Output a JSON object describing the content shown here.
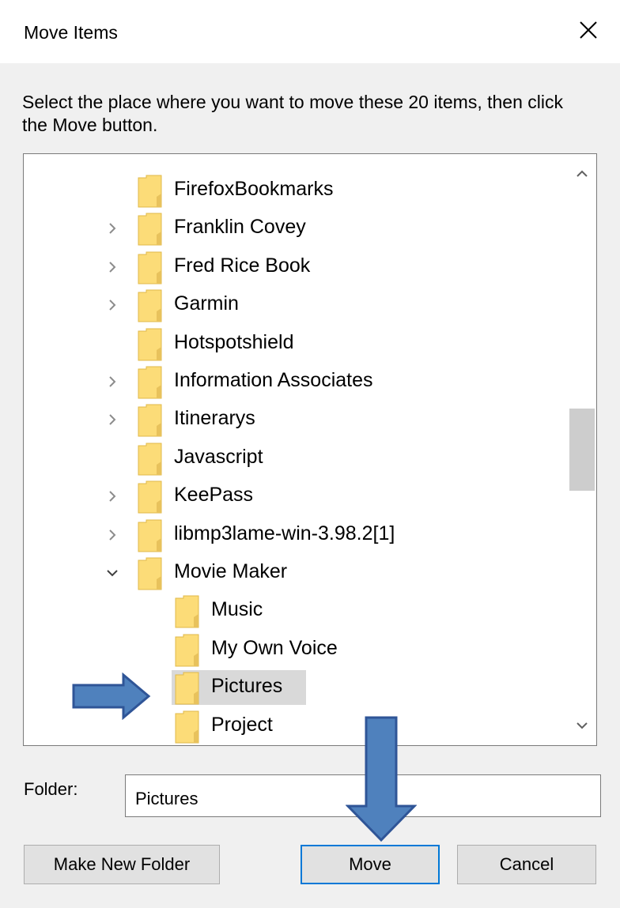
{
  "dialog": {
    "title": "Move Items",
    "instruction": "Select the place where you want to move these 20 items, then click the Move button."
  },
  "tree": {
    "items": [
      {
        "label": "FirefoxBookmarks",
        "expander": "none",
        "depth": 0,
        "selected": false
      },
      {
        "label": "Franklin Covey",
        "expander": "collapsed",
        "depth": 0,
        "selected": false
      },
      {
        "label": "Fred Rice Book",
        "expander": "collapsed",
        "depth": 0,
        "selected": false
      },
      {
        "label": "Garmin",
        "expander": "collapsed",
        "depth": 0,
        "selected": false
      },
      {
        "label": "Hotspotshield",
        "expander": "none",
        "depth": 0,
        "selected": false
      },
      {
        "label": "Information Associates",
        "expander": "collapsed",
        "depth": 0,
        "selected": false
      },
      {
        "label": "Itinerarys",
        "expander": "collapsed",
        "depth": 0,
        "selected": false
      },
      {
        "label": "Javascript",
        "expander": "none",
        "depth": 0,
        "selected": false
      },
      {
        "label": "KeePass",
        "expander": "collapsed",
        "depth": 0,
        "selected": false
      },
      {
        "label": "libmp3lame-win-3.98.2[1]",
        "expander": "collapsed",
        "depth": 0,
        "selected": false
      },
      {
        "label": "Movie Maker",
        "expander": "expanded",
        "depth": 0,
        "selected": false
      },
      {
        "label": "Music",
        "expander": "none",
        "depth": 1,
        "selected": false
      },
      {
        "label": "My Own Voice",
        "expander": "none",
        "depth": 1,
        "selected": false
      },
      {
        "label": "Pictures",
        "expander": "none",
        "depth": 1,
        "selected": true
      },
      {
        "label": "Project",
        "expander": "none",
        "depth": 1,
        "selected": false
      }
    ]
  },
  "folder_field": {
    "label": "Folder:",
    "value": "Pictures"
  },
  "buttons": {
    "make_new_folder": "Make New Folder",
    "move": "Move",
    "cancel": "Cancel"
  },
  "icons": {
    "close": "close-icon",
    "folder": "folder-icon",
    "expand": "chevron-right-icon",
    "collapse": "chevron-down-icon",
    "scroll_up": "scroll-up-icon",
    "scroll_down": "scroll-down-icon",
    "annotation": "blue-arrow-icon"
  },
  "colors": {
    "folder_fill": "#fcdc78",
    "selection": "#d9d9d9",
    "default_button_border": "#0078d7",
    "annotation_arrow": "#4f81bd"
  }
}
